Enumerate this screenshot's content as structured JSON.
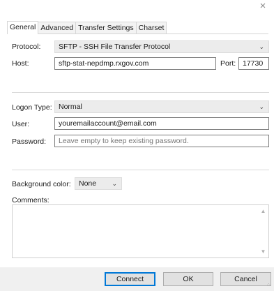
{
  "dialog": {
    "close_glyph": "×"
  },
  "tabs": [
    {
      "label": "General",
      "active": true
    },
    {
      "label": "Advanced",
      "active": false
    },
    {
      "label": "Transfer Settings",
      "active": false
    },
    {
      "label": "Charset",
      "active": false
    }
  ],
  "general": {
    "protocol_label": "Protocol:",
    "protocol_value": "SFTP - SSH File Transfer Protocol",
    "host_label": "Host:",
    "host_value": "sftp-stat-nepdmp.rxgov.com",
    "port_label": "Port:",
    "port_value": "17730",
    "logon_type_label": "Logon Type:",
    "logon_type_value": "Normal",
    "user_label": "User:",
    "user_value": "youremailaccount@email.com",
    "password_label": "Password:",
    "password_placeholder": "Leave empty to keep existing password.",
    "bg_color_label": "Background color:",
    "bg_color_value": "None",
    "comments_label": "Comments:"
  },
  "buttons": {
    "connect": "Connect",
    "ok": "OK",
    "cancel": "Cancel"
  },
  "icons": {
    "dropdown": "chevron-down-icon",
    "close": "close-icon",
    "scroll_up": "arrow-up-icon",
    "scroll_down": "arrow-down-icon",
    "grip": "resize-grip-icon"
  },
  "colors": {
    "focus_border": "#0078d7",
    "footer_bg": "#f0f0f0",
    "combo_bg": "#ececec"
  }
}
